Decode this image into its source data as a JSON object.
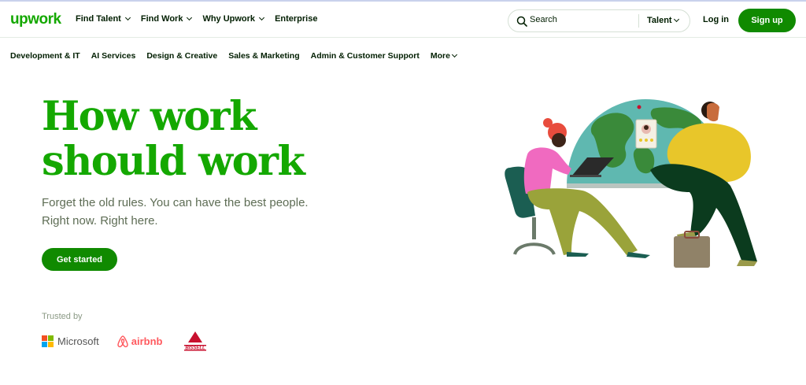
{
  "header": {
    "logo": "upwork",
    "nav": [
      {
        "label": "Find Talent",
        "dropdown": true
      },
      {
        "label": "Find Work",
        "dropdown": true
      },
      {
        "label": "Why Upwork",
        "dropdown": true
      },
      {
        "label": "Enterprise",
        "dropdown": false
      }
    ],
    "search": {
      "placeholder": "Search",
      "filter": "Talent"
    },
    "login": "Log in",
    "signup": "Sign up"
  },
  "categories": [
    "Development & IT",
    "AI Services",
    "Design & Creative",
    "Sales & Marketing",
    "Admin & Customer Support",
    "More"
  ],
  "hero": {
    "title_line1": "How work",
    "title_line2": "should work",
    "subtitle_line1": "Forget the old rules. You can have the best people.",
    "subtitle_line2": "Right now. Right here.",
    "cta": "Get started"
  },
  "trusted": {
    "label": "Trusted by",
    "brands": [
      "Microsoft",
      "airbnb",
      "BISSELL"
    ]
  },
  "colors": {
    "brand_green": "#14a800",
    "button_green": "#108a00"
  }
}
